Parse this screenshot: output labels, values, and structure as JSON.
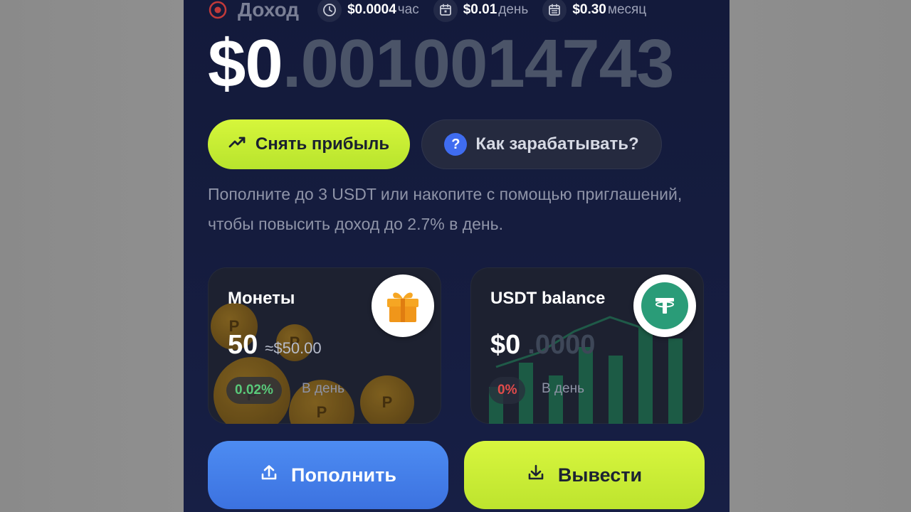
{
  "income": {
    "label": "Доход",
    "rates": [
      {
        "value": "$0.0004",
        "unit": "час",
        "icon": "clock-icon"
      },
      {
        "value": "$0.01",
        "unit": "день",
        "icon": "calendar-day-icon"
      },
      {
        "value": "$0.30",
        "unit": "месяц",
        "icon": "calendar-month-icon"
      }
    ]
  },
  "balance": {
    "integer_part": "$0",
    "fraction_part": ".0010014743"
  },
  "actions": {
    "withdraw_profit": "Снять прибыль",
    "how_to_earn": "Как зарабатывать?",
    "help_glyph": "?"
  },
  "hint_text": "Пополните до 3 USDT или накопите с помощью приглашений, чтобы повысить доход до 2.7% в день.",
  "coins_card": {
    "title": "Монеты",
    "amount": "50",
    "approx_value": "≈$50.00",
    "percent": "0.02%",
    "per_day": "В день"
  },
  "usdt_card": {
    "title": "USDT balance",
    "amount_integer": "$0",
    "amount_fraction": ".0000",
    "percent": "0%",
    "per_day": "В день"
  },
  "bottom": {
    "deposit": "Пополнить",
    "withdraw": "Вывести"
  },
  "colors": {
    "background": "#151c3e",
    "accent_lime": "#c8ee35",
    "accent_blue": "#4580ea",
    "positive": "#59c97a",
    "negative": "#e24b4b"
  }
}
